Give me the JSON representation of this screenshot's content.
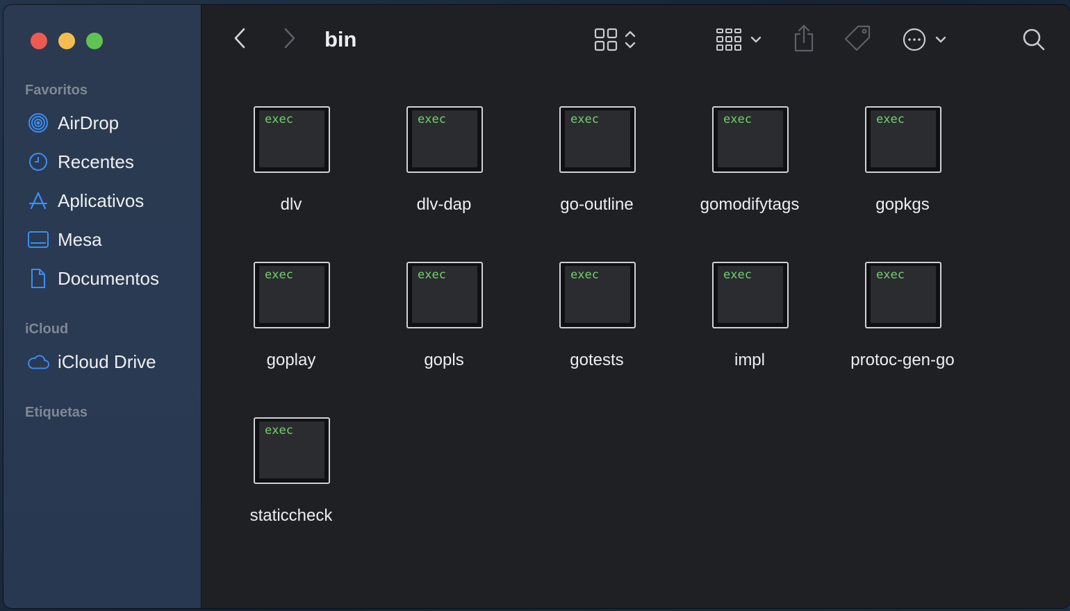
{
  "window": {
    "title": "bin"
  },
  "sidebar": {
    "sections": [
      {
        "header": "Favoritos",
        "items": [
          {
            "label": "AirDrop",
            "icon": "airdrop-icon"
          },
          {
            "label": "Recentes",
            "icon": "clock-icon"
          },
          {
            "label": "Aplicativos",
            "icon": "apps-icon"
          },
          {
            "label": "Mesa",
            "icon": "desktop-icon"
          },
          {
            "label": "Documentos",
            "icon": "document-icon"
          }
        ]
      },
      {
        "header": "iCloud",
        "items": [
          {
            "label": "iCloud Drive",
            "icon": "cloud-icon"
          }
        ]
      },
      {
        "header": "Etiquetas",
        "items": []
      }
    ]
  },
  "files": [
    {
      "name": "dlv",
      "badge": "exec"
    },
    {
      "name": "dlv-dap",
      "badge": "exec"
    },
    {
      "name": "go-outline",
      "badge": "exec"
    },
    {
      "name": "gomodifytags",
      "badge": "exec"
    },
    {
      "name": "gopkgs",
      "badge": "exec"
    },
    {
      "name": "goplay",
      "badge": "exec"
    },
    {
      "name": "gopls",
      "badge": "exec"
    },
    {
      "name": "gotests",
      "badge": "exec"
    },
    {
      "name": "impl",
      "badge": "exec"
    },
    {
      "name": "protoc-gen-go",
      "badge": "exec"
    },
    {
      "name": "staticcheck",
      "badge": "exec"
    }
  ],
  "colors": {
    "accent": "#3a8ef6",
    "exec_text": "#6fd36a",
    "close": "#ee5a52",
    "minimize": "#f5bd4f",
    "zoom": "#5fc454"
  }
}
